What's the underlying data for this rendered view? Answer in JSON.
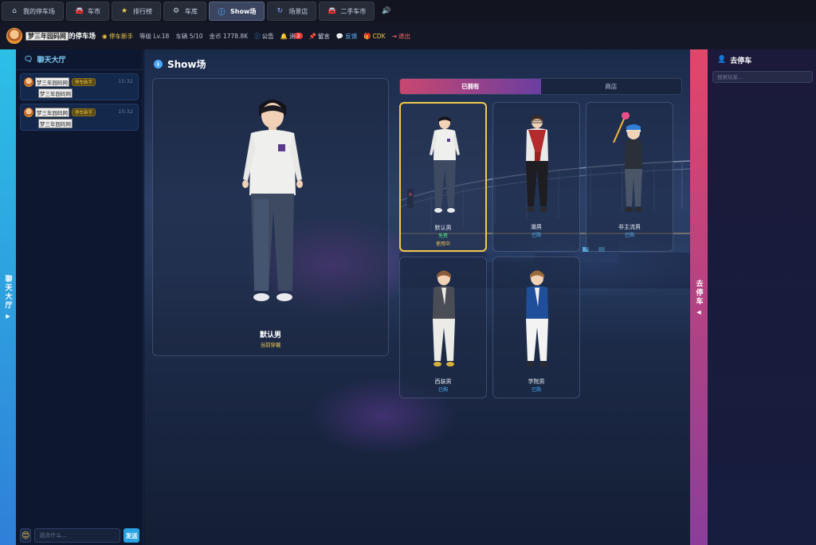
{
  "nav": {
    "tabs": [
      {
        "icon": "⌂",
        "label": "我的停车场"
      },
      {
        "icon": "🚘",
        "label": "车市"
      },
      {
        "icon": "★",
        "label": "排行榜"
      },
      {
        "icon": "⚙",
        "label": "车库"
      },
      {
        "icon": "ⓘ",
        "label": "Show场"
      },
      {
        "icon": "↻",
        "label": "场景店"
      },
      {
        "icon": "🚘",
        "label": "二手车市"
      }
    ],
    "active": "Show场",
    "sound_icon": "🔊"
  },
  "status": {
    "username_tag": "梦三年园码网",
    "username_suffix": "的停车场",
    "rank": "停车新手",
    "level": "等级 Lv.18",
    "cars": "车辆 5/10",
    "coins": "金币 1778.8K",
    "notice": "公告",
    "messages_label": "消",
    "messages_badge": "2",
    "guestbook": "留言",
    "feedback": "反馈",
    "cdk": "CDK",
    "logout": "退出"
  },
  "left_strip": {
    "label": "聊天大厅",
    "arrow": "▶"
  },
  "chat": {
    "title": "聊天大厅",
    "messages": [
      {
        "name": "梦三年园码网",
        "tag": "停车新手",
        "time": "15:32",
        "text": "梦三年园码网"
      },
      {
        "name": "梦三年园码网",
        "tag": "停车新手",
        "time": "15:32",
        "text": "梦三年园码网"
      }
    ],
    "emoji": "😊",
    "input_placeholder": "说点什么...",
    "send": "发送"
  },
  "stage": {
    "title": "Show场",
    "preview": {
      "name": "默认男",
      "sub": "当前穿戴"
    },
    "tabs": [
      "已拥有",
      "商店"
    ],
    "active_tab": "已拥有",
    "outfits": [
      {
        "name": "默认男",
        "status": "免费",
        "in_use": "使用中",
        "status_color": "green"
      },
      {
        "name": "潮男",
        "status": "已购"
      },
      {
        "name": "非主流男",
        "status": "已购"
      },
      {
        "name": "西装男",
        "status": "已购"
      },
      {
        "name": "学院男",
        "status": "已购"
      }
    ]
  },
  "right_strip": {
    "label": "去停车",
    "arrow": "◀"
  },
  "right_panel": {
    "title": "去停车",
    "search_placeholder": "搜索玩家..."
  },
  "colors": {
    "accent_gold": "#f2c94c",
    "accent_blue": "#27a3e3",
    "tab_grad_start": "#c9476f",
    "tab_grad_end": "#6a3ea1"
  }
}
